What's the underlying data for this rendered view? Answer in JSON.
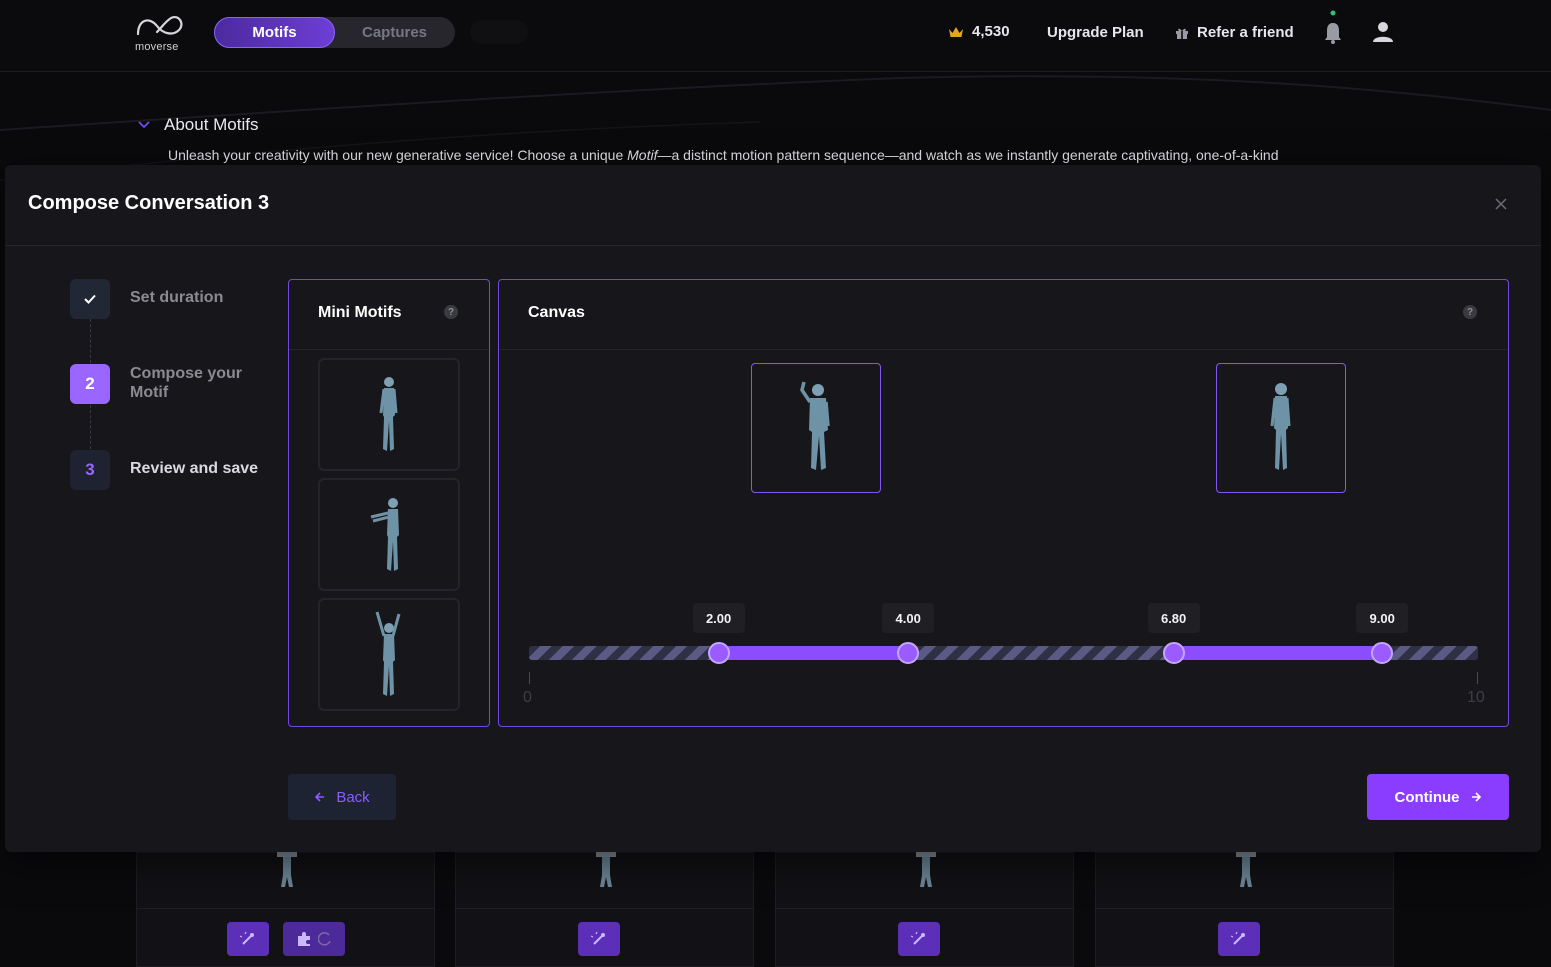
{
  "nav": {
    "logo_text": "moverse",
    "tabs": [
      {
        "label": "Motifs",
        "active": true
      },
      {
        "label": "Captures",
        "active": false
      }
    ],
    "credits": "4,530",
    "upgrade_label": "Upgrade Plan",
    "refer_label": "Refer a friend",
    "accent_color": "#8b3dff"
  },
  "about": {
    "title": "About Motifs",
    "desc_before": "Unleash your creativity with our new generative service! Choose a unique ",
    "desc_italic": "Motif",
    "desc_after": "—a distinct motion pattern sequence—and watch as we instantly generate captivating, one-of-a-kind"
  },
  "modal": {
    "title": "Compose Conversation 3",
    "steps": [
      {
        "badge": "",
        "label": "Set duration",
        "state": "done"
      },
      {
        "badge": "2",
        "label": "Compose your Motif",
        "state": "current"
      },
      {
        "badge": "3",
        "label": "Review and save",
        "state": "todo"
      }
    ],
    "mini_motifs": {
      "title": "Mini Motifs",
      "help": "?",
      "items": [
        "standing-figure",
        "arms-forward-figure",
        "arms-raised-figure"
      ]
    },
    "canvas": {
      "title": "Canvas",
      "help": "?",
      "placed": [
        "waving-figure",
        "standing-figure"
      ],
      "timeline": {
        "min": 0,
        "max": 10,
        "min_label": "0",
        "max_label": "10",
        "handles": [
          {
            "value": 2.0,
            "label": "2.00"
          },
          {
            "value": 4.0,
            "label": "4.00"
          },
          {
            "value": 6.8,
            "label": "6.80"
          },
          {
            "value": 9.0,
            "label": "9.00"
          }
        ],
        "segments": [
          [
            2.0,
            4.0
          ],
          [
            6.8,
            9.0
          ]
        ]
      }
    },
    "back_label": "Back",
    "continue_label": "Continue"
  }
}
